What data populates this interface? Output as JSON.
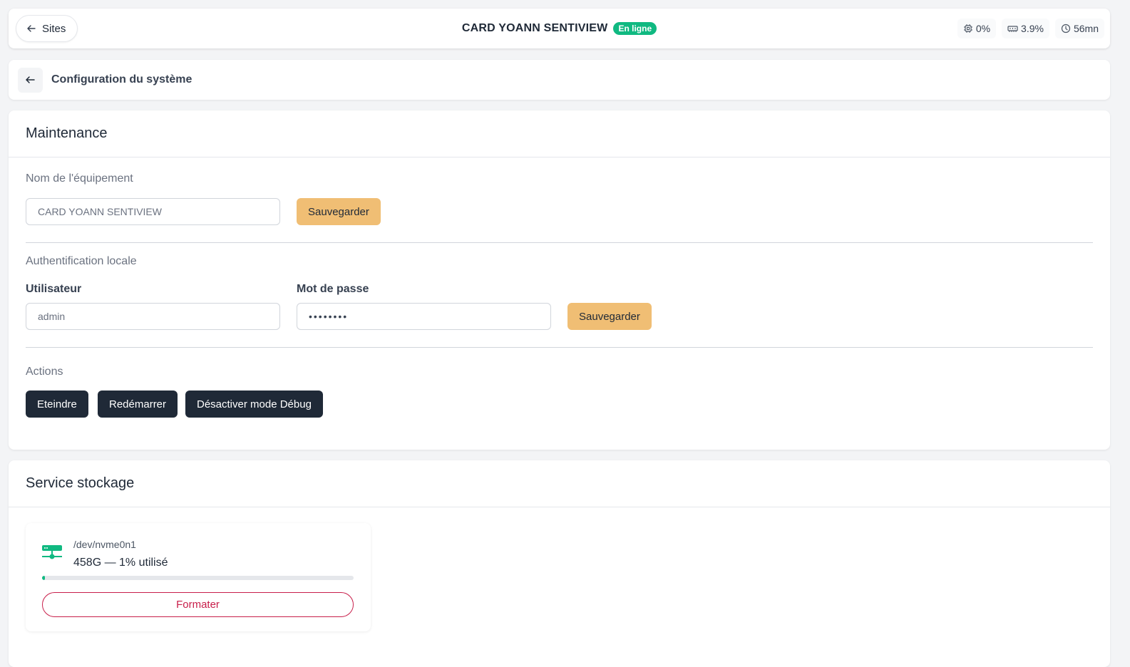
{
  "topbar": {
    "sites_label": "Sites",
    "device_name": "CARD YOANN SENTIVIEW",
    "status": "En ligne",
    "cpu": "0%",
    "memory": "3.9%",
    "uptime": "56mn"
  },
  "subbar": {
    "title": "Configuration du système"
  },
  "maintenance": {
    "title": "Maintenance",
    "device_name_label": "Nom de l'équipement",
    "device_name_value": "CARD YOANN SENTIVIEW",
    "save_label": "Sauvegarder",
    "auth_label": "Authentification locale",
    "user_label": "Utilisateur",
    "user_value": "admin",
    "password_label": "Mot de passe",
    "password_value": "••••••••",
    "auth_save_label": "Sauvegarder",
    "actions_label": "Actions",
    "actions": [
      "Eteindre",
      "Redémarrer",
      "Désactiver mode Débug"
    ]
  },
  "storage": {
    "title": "Service stockage",
    "disk": {
      "path": "/dev/nvme0n1",
      "summary": "458G — 1% utilisé",
      "used_percent": 1,
      "format_label": "Formater"
    }
  },
  "colors": {
    "accent_save": "#f0be74",
    "status_green": "#10b981",
    "danger": "#c81e4a",
    "dark_button": "#1f2937"
  }
}
